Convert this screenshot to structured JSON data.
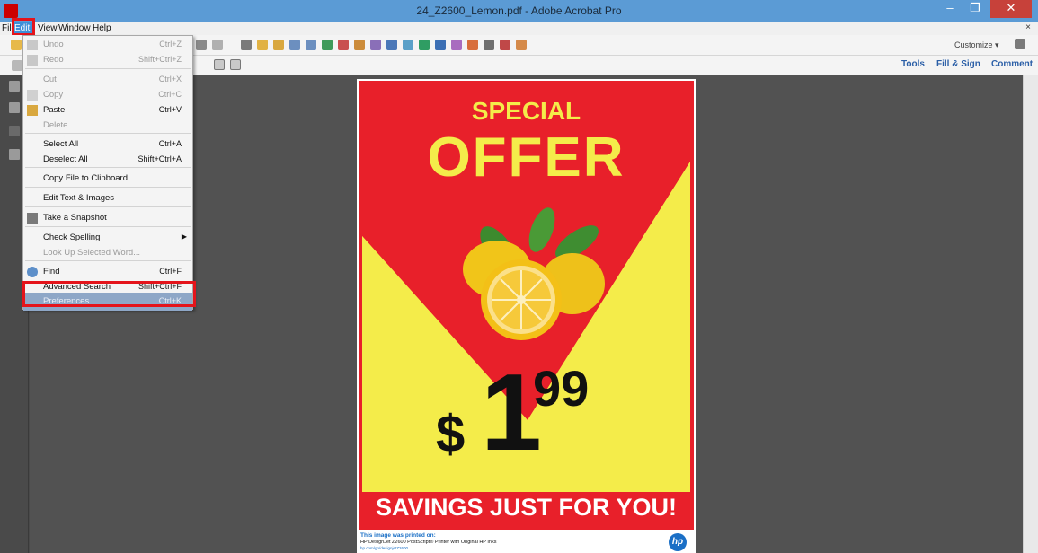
{
  "window": {
    "title": "24_Z2600_Lemon.pdf - Adobe Acrobat Pro",
    "minimize_glyph": "–",
    "maximize_glyph": "❐",
    "close_glyph": "✕"
  },
  "menubar": {
    "items": [
      "File",
      "Edit",
      "View",
      "Window",
      "Help"
    ],
    "close_glyph": "×"
  },
  "toolbar": {
    "customize_label": "Customize ▾",
    "tools_label": "Tools",
    "fill_sign_label": "Fill & Sign",
    "comment_label": "Comment"
  },
  "edit_menu": {
    "items": [
      {
        "label": "Undo",
        "shortcut": "Ctrl+Z"
      },
      {
        "label": "Redo",
        "shortcut": "Shift+Ctrl+Z"
      },
      {
        "label": "Cut",
        "shortcut": "Ctrl+X"
      },
      {
        "label": "Copy",
        "shortcut": "Ctrl+C"
      },
      {
        "label": "Paste",
        "shortcut": "Ctrl+V"
      },
      {
        "label": "Delete",
        "shortcut": ""
      },
      {
        "label": "Select All",
        "shortcut": "Ctrl+A"
      },
      {
        "label": "Deselect All",
        "shortcut": "Shift+Ctrl+A"
      },
      {
        "label": "Copy File to Clipboard",
        "shortcut": ""
      },
      {
        "label": "Edit Text & Images",
        "shortcut": ""
      },
      {
        "label": "Take a Snapshot",
        "shortcut": ""
      },
      {
        "label": "Check Spelling",
        "shortcut": ""
      },
      {
        "label": "Look Up Selected Word...",
        "shortcut": ""
      },
      {
        "label": "Find",
        "shortcut": "Ctrl+F"
      },
      {
        "label": "Advanced Search",
        "shortcut": "Shift+Ctrl+F"
      },
      {
        "label": "Preferences...",
        "shortcut": "Ctrl+K"
      }
    ]
  },
  "poster": {
    "special": "SPECIAL",
    "offer": "OFFER",
    "dollar": "$",
    "dollars": "1",
    "cents": "99",
    "savings": "SAVINGS JUST FOR YOU!",
    "printed_on": "This image was printed on:",
    "printer": "HP DesignJet Z2600 PostScript® Printer with Original HP Inks",
    "url": "hp.com/go/designjetZ2600",
    "logo": "hp"
  },
  "colors": {
    "titlebar": "#5b9bd5",
    "menu_active": "#3d8fd8",
    "highlight_box": "#e4141b",
    "poster_red": "#e8202a",
    "poster_yellow": "#f4ec4a"
  }
}
